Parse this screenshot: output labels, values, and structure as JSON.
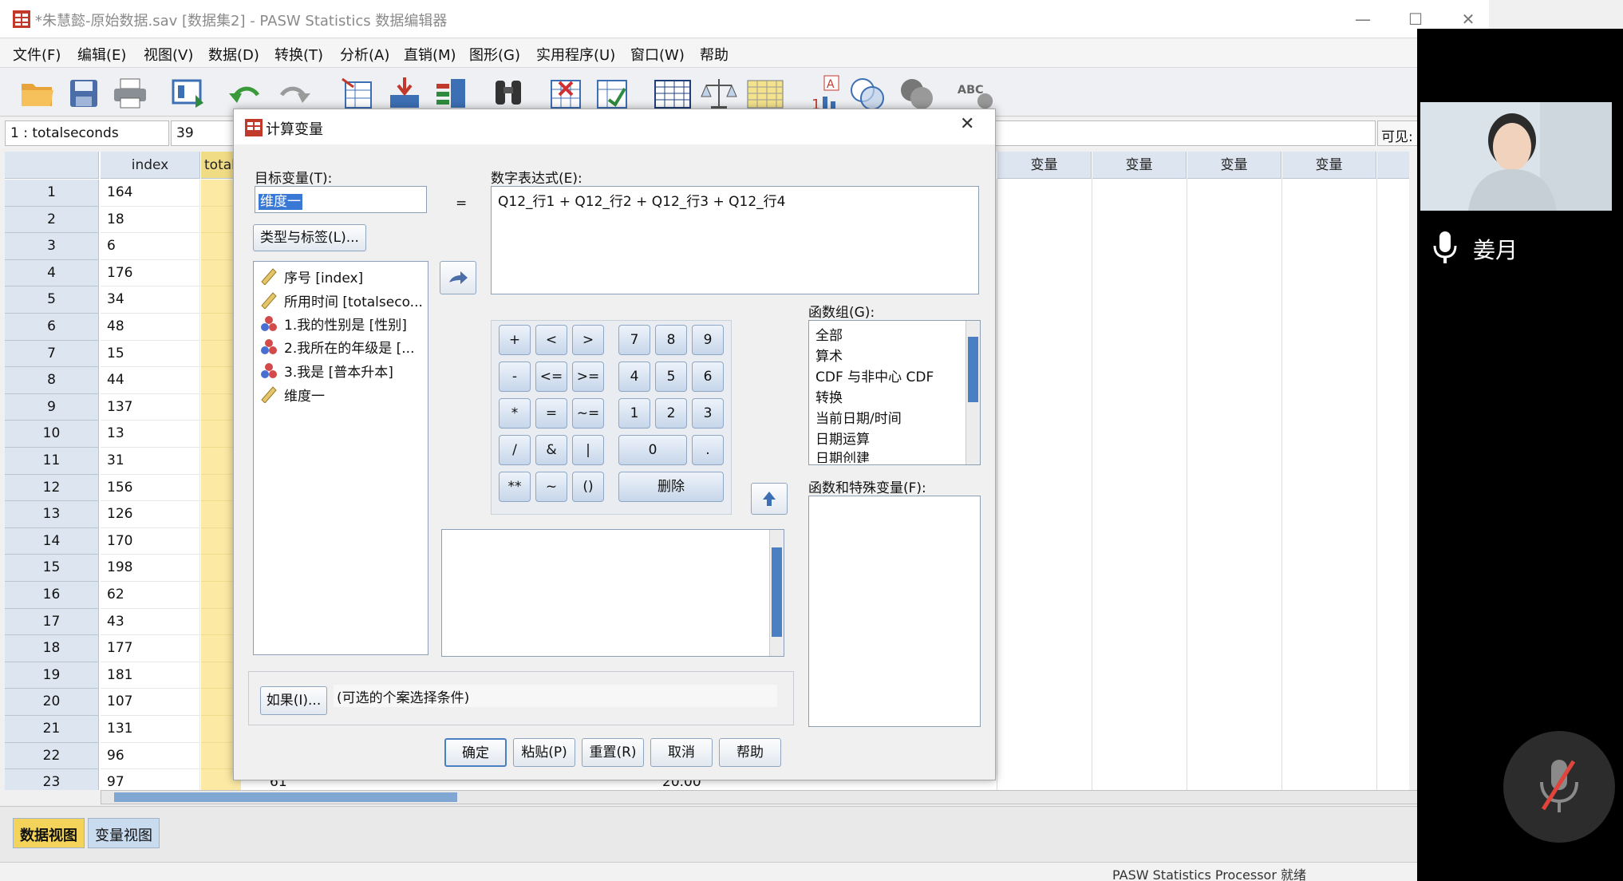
{
  "window": {
    "title": "*朱慧懿-原始数据.sav [数据集2] - PASW Statistics 数据编辑器",
    "controls": {
      "minimize": "—",
      "maximize": "☐",
      "close": "✕"
    }
  },
  "menu": [
    "文件(F)",
    "编辑(E)",
    "视图(V)",
    "数据(D)",
    "转换(T)",
    "分析(A)",
    "直销(M)",
    "图形(G)",
    "实用程序(U)",
    "窗口(W)",
    "帮助"
  ],
  "toolbar_icons": [
    "open-folder-icon",
    "save-icon",
    "print-icon",
    "dialog-recall-icon",
    "undo-icon",
    "redo-icon",
    "goto-case-icon",
    "goto-variable-icon",
    "variables-icon",
    "find-icon",
    "insert-cases-icon",
    "insert-variable-icon",
    "split-file-icon",
    "weight-cases-icon",
    "select-cases-icon",
    "value-labels-icon",
    "use-sets-icon",
    "show-all-variables-icon",
    "spell-check-icon"
  ],
  "cellbar": {
    "ref": "1 : totalseconds",
    "value": "39",
    "visible_label": "可见:"
  },
  "grid": {
    "headers": {
      "index": "index",
      "totalseconds": "totals",
      "var": "变量",
      "var_partial": "变"
    },
    "rows": [
      {
        "n": "1",
        "index": "164"
      },
      {
        "n": "2",
        "index": "18"
      },
      {
        "n": "3",
        "index": "6"
      },
      {
        "n": "4",
        "index": "176"
      },
      {
        "n": "5",
        "index": "34"
      },
      {
        "n": "6",
        "index": "48"
      },
      {
        "n": "7",
        "index": "15"
      },
      {
        "n": "8",
        "index": "44"
      },
      {
        "n": "9",
        "index": "137"
      },
      {
        "n": "10",
        "index": "13"
      },
      {
        "n": "11",
        "index": "31"
      },
      {
        "n": "12",
        "index": "156"
      },
      {
        "n": "13",
        "index": "126"
      },
      {
        "n": "14",
        "index": "170"
      },
      {
        "n": "15",
        "index": "198"
      },
      {
        "n": "16",
        "index": "62"
      },
      {
        "n": "17",
        "index": "43"
      },
      {
        "n": "18",
        "index": "177"
      },
      {
        "n": "19",
        "index": "181"
      },
      {
        "n": "20",
        "index": "107"
      },
      {
        "n": "21",
        "index": "131"
      },
      {
        "n": "22",
        "index": "96"
      },
      {
        "n": "23",
        "index": "97"
      }
    ],
    "peek_values": {
      "row23_a": "61",
      "row23_b": "20.00"
    }
  },
  "tabs": {
    "data_view": "数据视图",
    "variable_view": "变量视图"
  },
  "status": {
    "processor": "PASW Statistics Processor 就绪"
  },
  "dialog": {
    "title": "计算变量",
    "target_label": "目标变量(T):",
    "target_value": "维度一",
    "equals": "=",
    "expr_label": "数字表达式(E):",
    "expr_value": "Q12_行1 + Q12_行2 + Q12_行3 + Q12_行4",
    "type_label_button": "类型与标签(L)...",
    "variables": [
      {
        "icon": "scale-ruler-icon",
        "label": "序号 [index]"
      },
      {
        "icon": "scale-ruler-icon",
        "label": "所用时间 [totalseco..."
      },
      {
        "icon": "nominal-balls-icon",
        "label": "1.我的性别是 [性别]"
      },
      {
        "icon": "nominal-balls-icon",
        "label": "2.我所在的年级是 [..."
      },
      {
        "icon": "nominal-balls-icon",
        "label": "3.我是 [普本升本]"
      },
      {
        "icon": "scale-ruler-icon",
        "label": "维度一"
      }
    ],
    "keypad": {
      "row1": [
        "+",
        "<",
        ">",
        "7",
        "8",
        "9"
      ],
      "row2": [
        "-",
        "<=",
        ">=",
        "4",
        "5",
        "6"
      ],
      "row3": [
        "*",
        "=",
        "~=",
        "1",
        "2",
        "3"
      ],
      "row4": [
        "/",
        "&",
        "|",
        "0",
        "."
      ],
      "row5": [
        "**",
        "~",
        "()",
        "删除"
      ]
    },
    "func_group_label": "函数组(G):",
    "func_groups": [
      "全部",
      "算术",
      "CDF 与非中心 CDF",
      "转换",
      "当前日期/时间",
      "日期运算",
      "日期创建"
    ],
    "func_vars_label": "函数和特殊变量(F):",
    "if_button": "如果(I)...",
    "if_text": "(可选的个案选择条件)",
    "buttons": {
      "ok": "确定",
      "paste": "粘贴(P)",
      "reset": "重置(R)",
      "cancel": "取消",
      "help": "帮助"
    }
  },
  "meeting": {
    "speaker_name": "姜月"
  },
  "colors": {
    "title_grey": "#8a8a8a",
    "header_blue": "#dde5f0",
    "selection": "#3a78d6",
    "yellow_col": "#fbe9a4"
  }
}
